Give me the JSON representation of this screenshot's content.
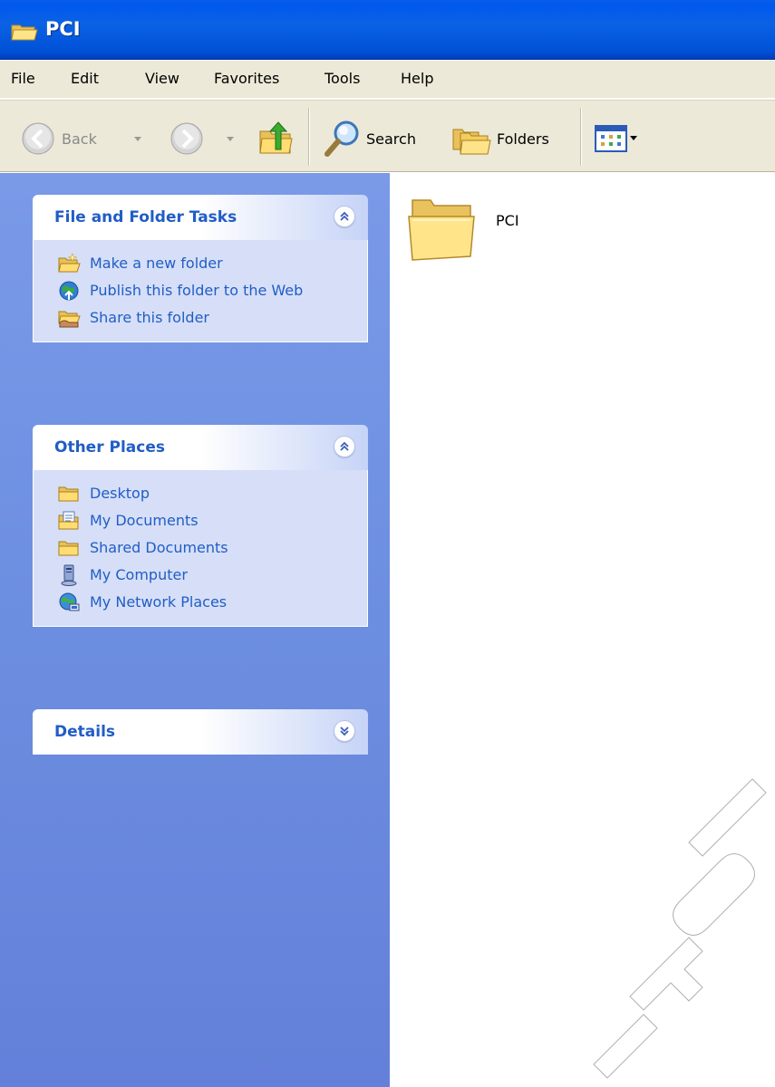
{
  "window": {
    "title": "PCI"
  },
  "menu": [
    "File",
    "Edit",
    "View",
    "Favorites",
    "Tools",
    "Help"
  ],
  "toolbar": {
    "back_label": "Back",
    "search_label": "Search",
    "folders_label": "Folders"
  },
  "taskpane": {
    "file_tasks": {
      "title": "File and Folder Tasks",
      "items": [
        {
          "label": "Make a new folder",
          "icon": "new-folder-icon"
        },
        {
          "label": "Publish this folder to the Web",
          "icon": "publish-web-icon"
        },
        {
          "label": "Share this folder",
          "icon": "share-folder-icon"
        }
      ]
    },
    "other_places": {
      "title": "Other Places",
      "items": [
        {
          "label": "Desktop",
          "icon": "folder-icon"
        },
        {
          "label": "My Documents",
          "icon": "my-documents-icon"
        },
        {
          "label": "Shared Documents",
          "icon": "folder-icon"
        },
        {
          "label": "My Computer",
          "icon": "my-computer-icon"
        },
        {
          "label": "My Network Places",
          "icon": "network-places-icon"
        }
      ]
    },
    "details": {
      "title": "Details"
    }
  },
  "files": [
    {
      "name": "PCI",
      "icon": "folder-icon"
    }
  ],
  "colors": {
    "titlebar": "#0058EE",
    "taskpane": "#6C8EE0",
    "panel_title": "#215DC6",
    "panel_body": "#D6DFF7",
    "chrome": "#ECE9D8"
  }
}
